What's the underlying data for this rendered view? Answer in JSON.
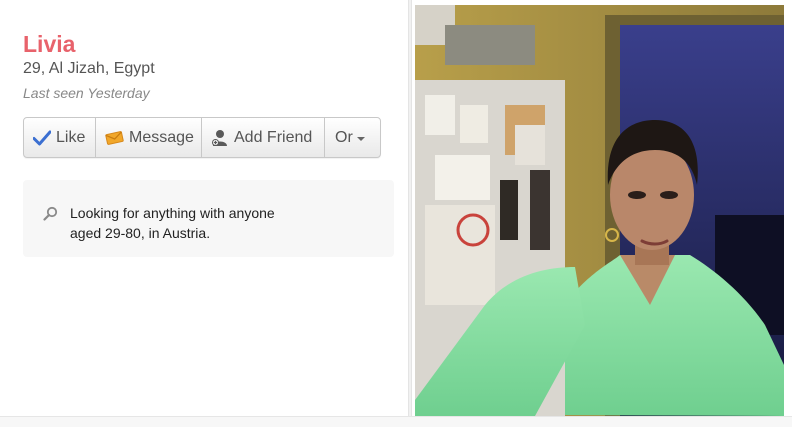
{
  "profile": {
    "name": "Livia",
    "location": "29, Al Jizah, Egypt",
    "last_seen": "Last seen Yesterday"
  },
  "actions": {
    "like": "Like",
    "message": "Message",
    "add_friend": "Add Friend",
    "or": "Or"
  },
  "looking_for": {
    "line1": "Looking for anything with anyone",
    "line2": "aged 29-80, in Austria."
  },
  "colors": {
    "name": "#e8626b",
    "like_icon": "#3b6fd1",
    "message_icon": "#f1a72a",
    "shirt": "#8ee0a6"
  },
  "icons": {
    "like": "check-icon",
    "message": "envelope-icon",
    "add_friend": "person-add-icon",
    "or": "caret-down-icon",
    "looking": "search-icon"
  }
}
